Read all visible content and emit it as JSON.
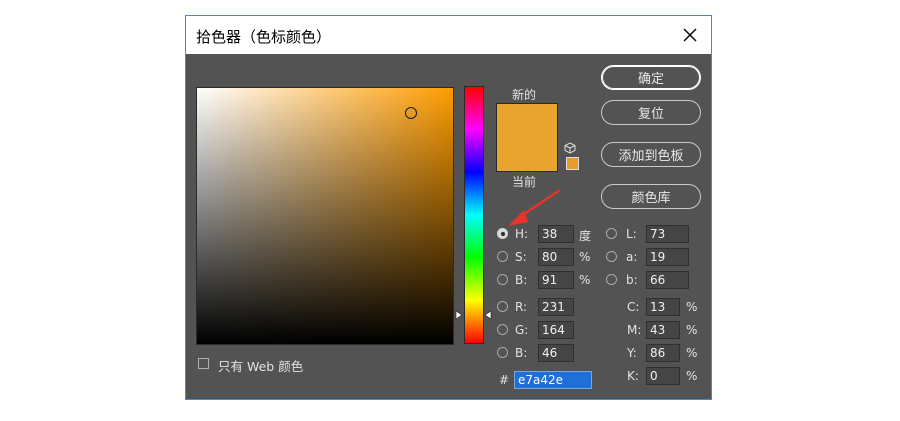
{
  "window": {
    "title": "拾色器（色标颜色）"
  },
  "swatches": {
    "new_label": "新的",
    "current_label": "当前",
    "new_color": "#e7a42e",
    "current_color": "#e7a42e"
  },
  "buttons": {
    "ok": "确定",
    "reset": "复位",
    "add_swatch": "添加到色板",
    "libraries": "颜色库"
  },
  "hsb": {
    "h": {
      "label": "H:",
      "value": "38",
      "unit": "度"
    },
    "s": {
      "label": "S:",
      "value": "80",
      "unit": "%"
    },
    "b": {
      "label": "B:",
      "value": "91",
      "unit": "%"
    }
  },
  "rgb": {
    "r": {
      "label": "R:",
      "value": "231"
    },
    "g": {
      "label": "G:",
      "value": "164"
    },
    "b": {
      "label": "B:",
      "value": "46"
    }
  },
  "lab": {
    "l": {
      "label": "L:",
      "value": "73"
    },
    "a": {
      "label": "a:",
      "value": "19"
    },
    "b": {
      "label": "b:",
      "value": "66"
    }
  },
  "cmyk": {
    "c": {
      "label": "C:",
      "value": "13",
      "unit": "%"
    },
    "m": {
      "label": "M:",
      "value": "43",
      "unit": "%"
    },
    "y": {
      "label": "Y:",
      "value": "86",
      "unit": "%"
    },
    "k": {
      "label": "K:",
      "value": "0",
      "unit": "%"
    }
  },
  "hex": {
    "label": "#",
    "value": "e7a42e"
  },
  "web_only": {
    "label": "只有 Web 颜色"
  }
}
